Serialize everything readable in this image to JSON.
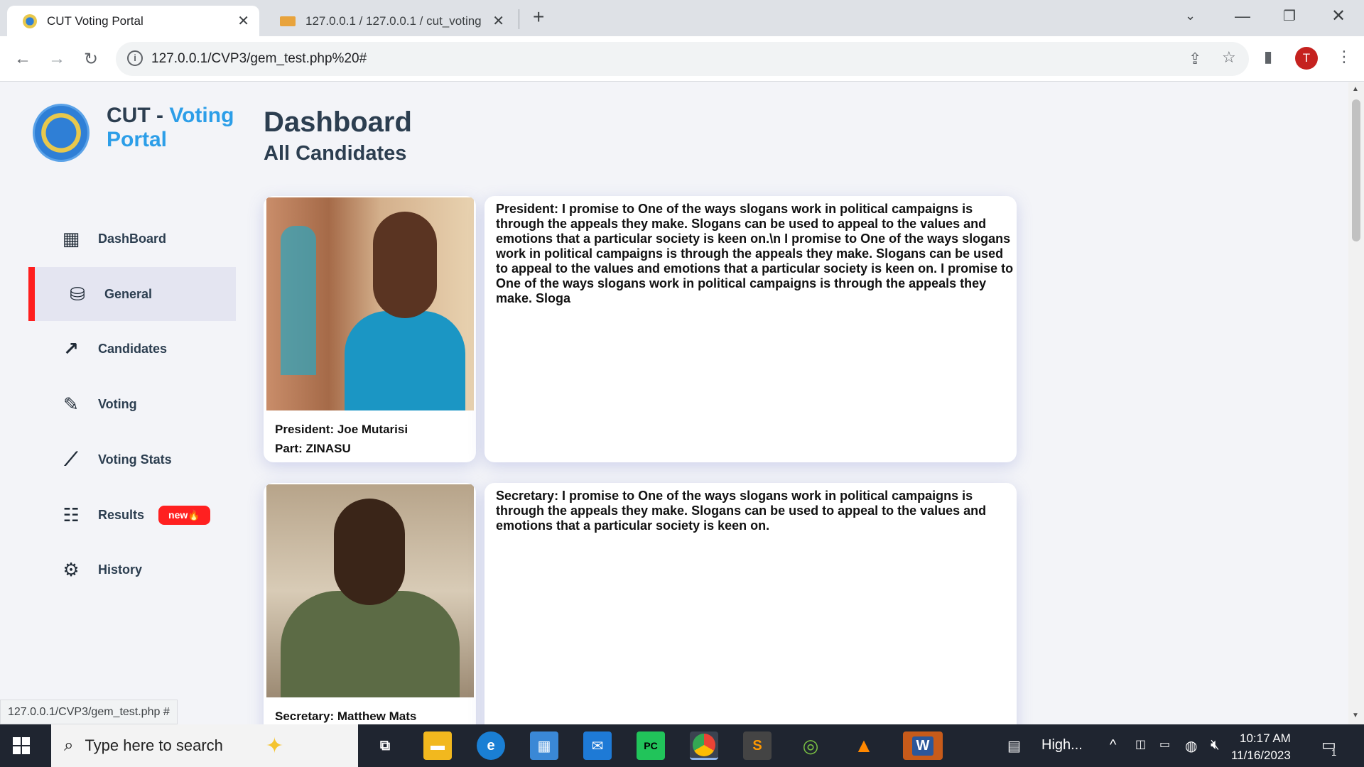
{
  "browser": {
    "tabs": [
      {
        "title": "CUT Voting Portal",
        "active": true
      },
      {
        "title": "127.0.0.1 / 127.0.0.1 / cut_voting",
        "active": false
      }
    ],
    "url": "127.0.0.1/CVP3/gem_test.php%20#",
    "profile_initial": "T",
    "status_url": "127.0.0.1/CVP3/gem_test.php #"
  },
  "sidebar": {
    "brand_main": "CUT - ",
    "brand_accent_1": "Voting",
    "brand_accent_2": "Portal",
    "items": [
      {
        "label": "DashBoard",
        "icon": "dashboard-icon"
      },
      {
        "label": "General",
        "icon": "database-icon",
        "active": true
      },
      {
        "label": "Candidates",
        "icon": "trending-up-icon"
      },
      {
        "label": "Voting",
        "icon": "ballot-icon"
      },
      {
        "label": "Voting Stats",
        "icon": "stats-icon"
      },
      {
        "label": "Results",
        "icon": "results-icon",
        "badge": "new🔥"
      },
      {
        "label": "History",
        "icon": "history-icon"
      }
    ]
  },
  "main": {
    "title": "Dashboard",
    "subtitle": "All Candidates",
    "candidates": [
      {
        "role_name": "President: Joe Mutarisi",
        "party": "Part: ZINASU",
        "manifesto": "President: I promise to One of the ways slogans work in political campaigns is through the appeals they make. Slogans can be used to appeal to the values and emotions that a particular society is keen on.\\n I promise to One of the ways slogans work in political campaigns is through the appeals they make. Slogans can be used to appeal to the values and emotions that a particular society is keen on. I promise to One of the ways slogans work in political campaigns is through the appeals they make. Sloga"
      },
      {
        "role_name": "Secretary: Matthew Mats",
        "party": "",
        "manifesto": "Secretary: I promise to One of the ways slogans work in political campaigns is through the appeals they make. Slogans can be used to appeal to the values and emotions that a particular society is keen on."
      }
    ]
  },
  "taskbar": {
    "search_placeholder": "Type here to search",
    "weather_text": "High...",
    "time": "10:17 AM",
    "date": "11/16/2023",
    "notification_count": "1"
  }
}
